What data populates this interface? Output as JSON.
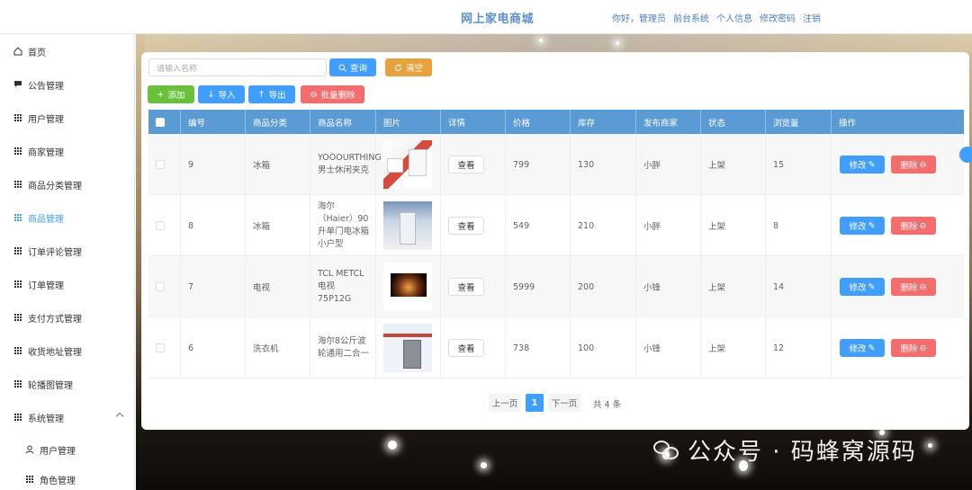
{
  "header": {
    "title": "网上家电商城",
    "nav": [
      "你好，管理员",
      "前台系统",
      "个人信息",
      "修改密码",
      "注销"
    ]
  },
  "sidebar": {
    "items": [
      {
        "label": "首页",
        "icon": "home-icon"
      },
      {
        "label": "公告管理",
        "icon": "message-icon"
      },
      {
        "label": "用户管理",
        "icon": "grid-icon"
      },
      {
        "label": "商家管理",
        "icon": "grid-icon"
      },
      {
        "label": "商品分类管理",
        "icon": "grid-icon"
      },
      {
        "label": "商品管理",
        "icon": "grid-icon",
        "active": true
      },
      {
        "label": "订单评论管理",
        "icon": "grid-icon"
      },
      {
        "label": "订单管理",
        "icon": "grid-icon"
      },
      {
        "label": "支付方式管理",
        "icon": "grid-icon"
      },
      {
        "label": "收货地址管理",
        "icon": "grid-icon"
      },
      {
        "label": "轮播图管理",
        "icon": "grid-icon"
      },
      {
        "label": "系统管理",
        "icon": "grid-icon"
      },
      {
        "label": "用户管理",
        "icon": "user-icon"
      },
      {
        "label": "角色管理",
        "icon": "grid-icon"
      }
    ]
  },
  "toolbar": {
    "search_placeholder": "请输入名称",
    "query": "查询",
    "reset": "清空",
    "add": "添加",
    "import": "导入",
    "export": "导出",
    "batch_delete": "批量删除"
  },
  "table": {
    "headers": [
      "编号",
      "商品分类",
      "商品名称",
      "图片",
      "详情",
      "价格",
      "库存",
      "发布商家",
      "状态",
      "浏览量",
      "操作"
    ],
    "rows": [
      {
        "id": "9",
        "category": "冰箱",
        "name": "YOOOURTHING男士休闲夹克",
        "image": "fridge-a",
        "detail": "查看",
        "price": "799",
        "stock": "130",
        "merchant": "小胖",
        "status": "上架",
        "views": "15"
      },
      {
        "id": "8",
        "category": "冰箱",
        "name": "海尔（Haier）90升单门电冰箱小户型",
        "image": "fridge-b",
        "detail": "查看",
        "price": "549",
        "stock": "210",
        "merchant": "小胖",
        "status": "上架",
        "views": "8"
      },
      {
        "id": "7",
        "category": "电视",
        "name": "TCL METCL电视 75P12G",
        "image": "tv",
        "detail": "查看",
        "price": "5999",
        "stock": "200",
        "merchant": "小锋",
        "status": "上架",
        "views": "14"
      },
      {
        "id": "6",
        "category": "洗衣机",
        "name": "海尔8公斤波轮通用二合一",
        "image": "washer",
        "detail": "查看",
        "price": "738",
        "stock": "100",
        "merchant": "小锋",
        "status": "上架",
        "views": "12"
      }
    ],
    "edit_label": "修改",
    "delete_label": "删除"
  },
  "pagination": {
    "prev": "上一页",
    "current": "1",
    "next": "下一页",
    "total": "共 4 条"
  },
  "watermark": "公众号 · 码蜂窝源码",
  "colors": {
    "primary": "#409eff",
    "header": "#5b9bd5",
    "danger": "#f56c6c",
    "success": "#67c23a",
    "warning": "#e6a23c"
  }
}
